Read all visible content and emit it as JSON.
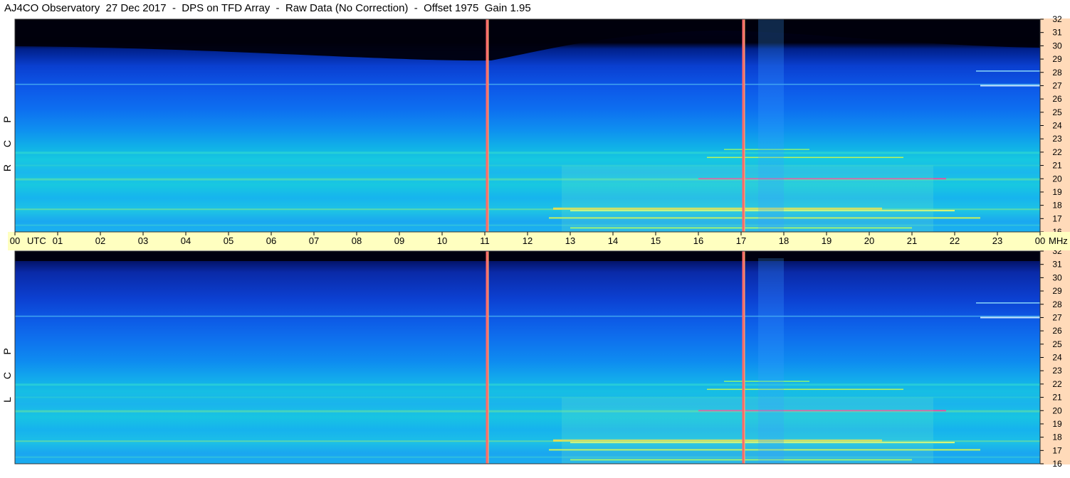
{
  "title": "AJ4CO Observatory  27 Dec 2017  -  DPS on TFD Array  -  Raw Data (No Correction)  -  Offset 1975  Gain 1.95",
  "panels": [
    {
      "label_letters": [
        "R",
        "C",
        "P"
      ]
    },
    {
      "label_letters": [
        "L",
        "C",
        "P"
      ]
    }
  ],
  "colors": {
    "background": "#ffffff",
    "utc_strip": "#ffffc0",
    "freq_strip": "#ffdab9",
    "marker_line_a": "#ff6a6a",
    "marker_line_b": "#ffb070"
  },
  "chart_data": {
    "type": "heatmap",
    "title": "AJ4CO Observatory  27 Dec 2017  -  DPS on TFD Array  -  Raw Data (No Correction)  -  Offset 1975  Gain 1.95",
    "xlabel": "UTC",
    "ylabel": "MHz",
    "x_tick_labels": [
      "00",
      "01",
      "02",
      "03",
      "04",
      "05",
      "06",
      "07",
      "08",
      "09",
      "10",
      "11",
      "12",
      "13",
      "14",
      "15",
      "16",
      "17",
      "18",
      "19",
      "20",
      "21",
      "22",
      "23",
      "00"
    ],
    "x_unit_label": "UTC",
    "y_tick_labels": [
      "32",
      "31",
      "30",
      "29",
      "28",
      "27",
      "26",
      "25",
      "24",
      "23",
      "22",
      "21",
      "20",
      "19",
      "18",
      "17",
      "16"
    ],
    "y_unit_label": "MHz",
    "xlim": [
      0,
      24
    ],
    "ylim": [
      16,
      32
    ],
    "panels": [
      "RCP",
      "LCP"
    ],
    "vertical_markers_utc": [
      11.05,
      17.05
    ],
    "colormap": "dark-blue -> blue -> cyan -> yellow -> red"
  }
}
